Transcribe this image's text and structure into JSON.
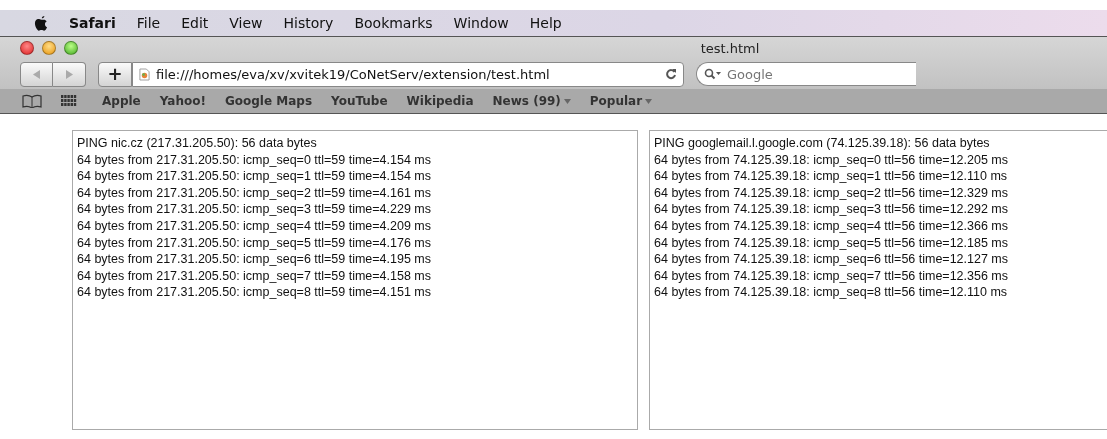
{
  "menu_bar": {
    "items": [
      {
        "label": "Safari",
        "kind": "app"
      },
      {
        "label": "File",
        "kind": "menu"
      },
      {
        "label": "Edit",
        "kind": "menu"
      },
      {
        "label": "View",
        "kind": "menu"
      },
      {
        "label": "History",
        "kind": "menu"
      },
      {
        "label": "Bookmarks",
        "kind": "menu"
      },
      {
        "label": "Window",
        "kind": "menu"
      },
      {
        "label": "Help",
        "kind": "menu"
      }
    ]
  },
  "window": {
    "title": "test.html"
  },
  "toolbar": {
    "back_disabled": true,
    "forward_disabled": true,
    "add_button": "+",
    "url": "file:///homes/eva/xv/xvitek19/CoNetServ/extension/test.html",
    "search": {
      "placeholder": "Google"
    }
  },
  "bookmarks_bar": {
    "items": [
      {
        "label": "Apple",
        "has_menu": false
      },
      {
        "label": "Yahoo!",
        "has_menu": false
      },
      {
        "label": "Google Maps",
        "has_menu": false
      },
      {
        "label": "YouTube",
        "has_menu": false
      },
      {
        "label": "Wikipedia",
        "has_menu": false
      },
      {
        "label": "News (99)",
        "has_menu": true
      },
      {
        "label": "Popular",
        "has_menu": true
      }
    ]
  },
  "panes": [
    {
      "lines": [
        "PING nic.cz (217.31.205.50): 56 data bytes",
        "64 bytes from 217.31.205.50: icmp_seq=0 ttl=59 time=4.154 ms",
        "64 bytes from 217.31.205.50: icmp_seq=1 ttl=59 time=4.154 ms",
        "64 bytes from 217.31.205.50: icmp_seq=2 ttl=59 time=4.161 ms",
        "64 bytes from 217.31.205.50: icmp_seq=3 ttl=59 time=4.229 ms",
        "64 bytes from 217.31.205.50: icmp_seq=4 ttl=59 time=4.209 ms",
        "64 bytes from 217.31.205.50: icmp_seq=5 ttl=59 time=4.176 ms",
        "64 bytes from 217.31.205.50: icmp_seq=6 ttl=59 time=4.195 ms",
        "64 bytes from 217.31.205.50: icmp_seq=7 ttl=59 time=4.158 ms",
        "64 bytes from 217.31.205.50: icmp_seq=8 ttl=59 time=4.151 ms"
      ]
    },
    {
      "lines": [
        "PING googlemail.l.google.com (74.125.39.18): 56 data bytes",
        "64 bytes from 74.125.39.18: icmp_seq=0 ttl=56 time=12.205 ms",
        "64 bytes from 74.125.39.18: icmp_seq=1 ttl=56 time=12.110 ms",
        "64 bytes from 74.125.39.18: icmp_seq=2 ttl=56 time=12.329 ms",
        "64 bytes from 74.125.39.18: icmp_seq=3 ttl=56 time=12.292 ms",
        "64 bytes from 74.125.39.18: icmp_seq=4 ttl=56 time=12.366 ms",
        "64 bytes from 74.125.39.18: icmp_seq=5 ttl=56 time=12.185 ms",
        "64 bytes from 74.125.39.18: icmp_seq=6 ttl=56 time=12.127 ms",
        "64 bytes from 74.125.39.18: icmp_seq=7 ttl=56 time=12.356 ms",
        "64 bytes from 74.125.39.18: icmp_seq=8 ttl=56 time=12.110 ms"
      ]
    }
  ]
}
